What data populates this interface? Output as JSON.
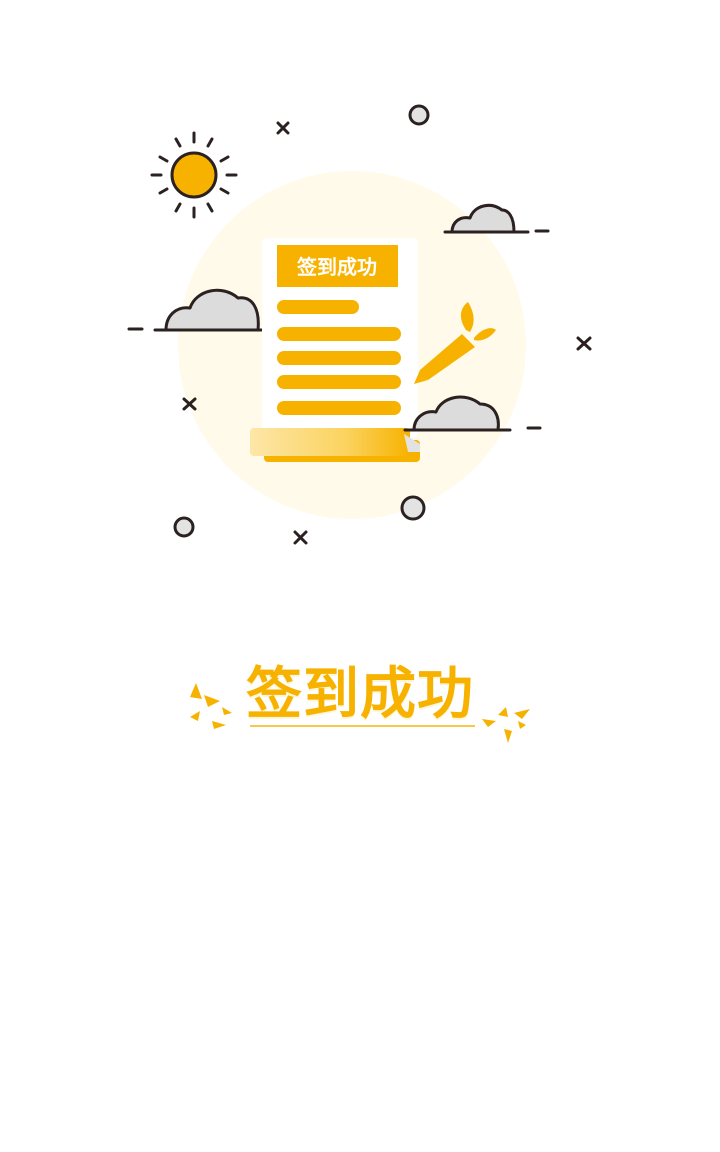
{
  "document_card": {
    "header_label": "签到成功"
  },
  "result": {
    "title": "签到成功"
  },
  "colors": {
    "accent": "#f7b200",
    "halo": "#fffaea",
    "outline": "#2b2121",
    "cloud": "#dcdcdc"
  }
}
